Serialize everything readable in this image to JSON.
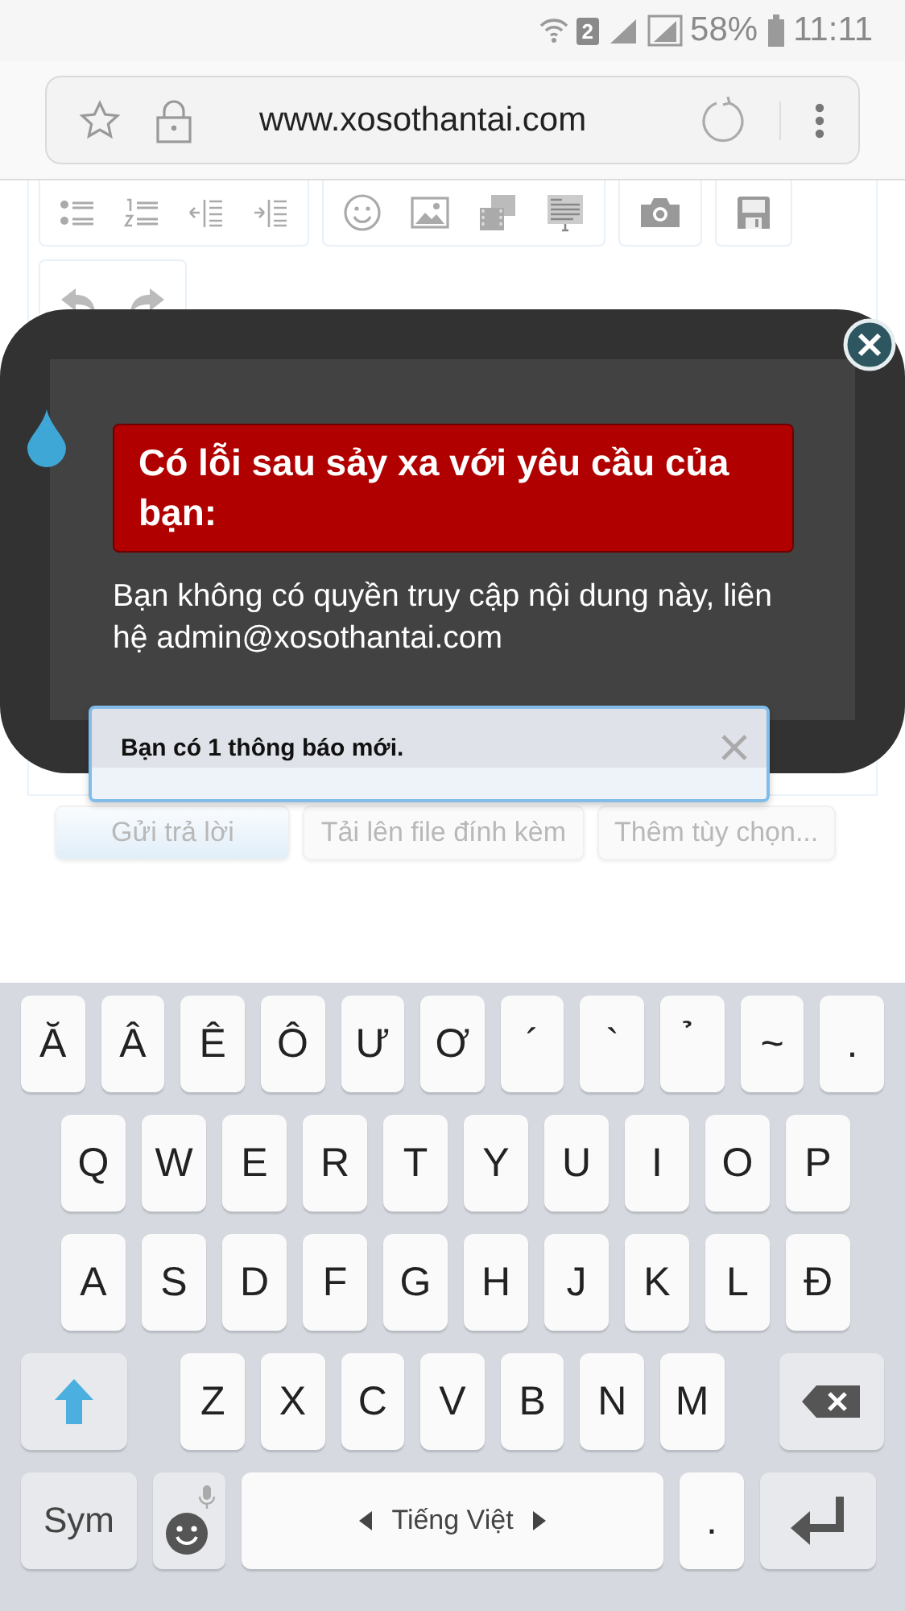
{
  "status_bar": {
    "sim_badge": "2",
    "battery": "58%",
    "time": "11:11"
  },
  "address_bar": {
    "url": "www.xosothantai.com"
  },
  "dialog": {
    "title": "Có lỗi sau sảy xa với yêu cầu của bạn:",
    "message": "Bạn không có quyền truy cập nội dung này, liên hệ admin@xosothantai.com"
  },
  "notification": {
    "text": "Bạn có 1 thông báo mới."
  },
  "buttons": [
    {
      "label": "Gửi trả lời",
      "kind": "primary"
    },
    {
      "label": "Tải lên file đính kèm",
      "kind": "secondary"
    },
    {
      "label": "Thêm tùy chọn...",
      "kind": "secondary"
    }
  ],
  "keyboard": {
    "rows": [
      {
        "keys": [
          {
            "kind": "char",
            "label": "Ă"
          },
          {
            "kind": "char",
            "label": "Â"
          },
          {
            "kind": "char",
            "label": "Ê"
          },
          {
            "kind": "char",
            "label": "Ô"
          },
          {
            "kind": "char",
            "label": "Ư"
          },
          {
            "kind": "char",
            "label": "Ơ"
          },
          {
            "kind": "char",
            "label": "´"
          },
          {
            "kind": "char",
            "label": "`"
          },
          {
            "kind": "char",
            "label": "̉"
          },
          {
            "kind": "char",
            "label": "~"
          },
          {
            "kind": "char",
            "label": "."
          }
        ]
      },
      {
        "keys": [
          {
            "kind": "char",
            "label": "Q"
          },
          {
            "kind": "char",
            "label": "W"
          },
          {
            "kind": "char",
            "label": "E"
          },
          {
            "kind": "char",
            "label": "R"
          },
          {
            "kind": "char",
            "label": "T"
          },
          {
            "kind": "char",
            "label": "Y"
          },
          {
            "kind": "char",
            "label": "U"
          },
          {
            "kind": "char",
            "label": "I"
          },
          {
            "kind": "char",
            "label": "O"
          },
          {
            "kind": "char",
            "label": "P"
          }
        ]
      },
      {
        "keys": [
          {
            "kind": "char",
            "label": "A"
          },
          {
            "kind": "char",
            "label": "S"
          },
          {
            "kind": "char",
            "label": "D"
          },
          {
            "kind": "char",
            "label": "F"
          },
          {
            "kind": "char",
            "label": "G"
          },
          {
            "kind": "char",
            "label": "H"
          },
          {
            "kind": "char",
            "label": "J"
          },
          {
            "kind": "char",
            "label": "K"
          },
          {
            "kind": "char",
            "label": "L"
          },
          {
            "kind": "char",
            "label": "Đ"
          }
        ]
      },
      {
        "keys": [
          {
            "kind": "shift"
          },
          {
            "kind": "char",
            "label": "Z"
          },
          {
            "kind": "char",
            "label": "X"
          },
          {
            "kind": "char",
            "label": "C"
          },
          {
            "kind": "char",
            "label": "V"
          },
          {
            "kind": "char",
            "label": "B"
          },
          {
            "kind": "char",
            "label": "N"
          },
          {
            "kind": "char",
            "label": "M"
          },
          {
            "kind": "backspace"
          }
        ]
      },
      {
        "keys": [
          {
            "kind": "sym",
            "label": "Sym"
          },
          {
            "kind": "emoji"
          },
          {
            "kind": "space",
            "label": "Tiếng Việt"
          },
          {
            "kind": "char",
            "label": "."
          },
          {
            "kind": "enter"
          }
        ]
      }
    ]
  }
}
